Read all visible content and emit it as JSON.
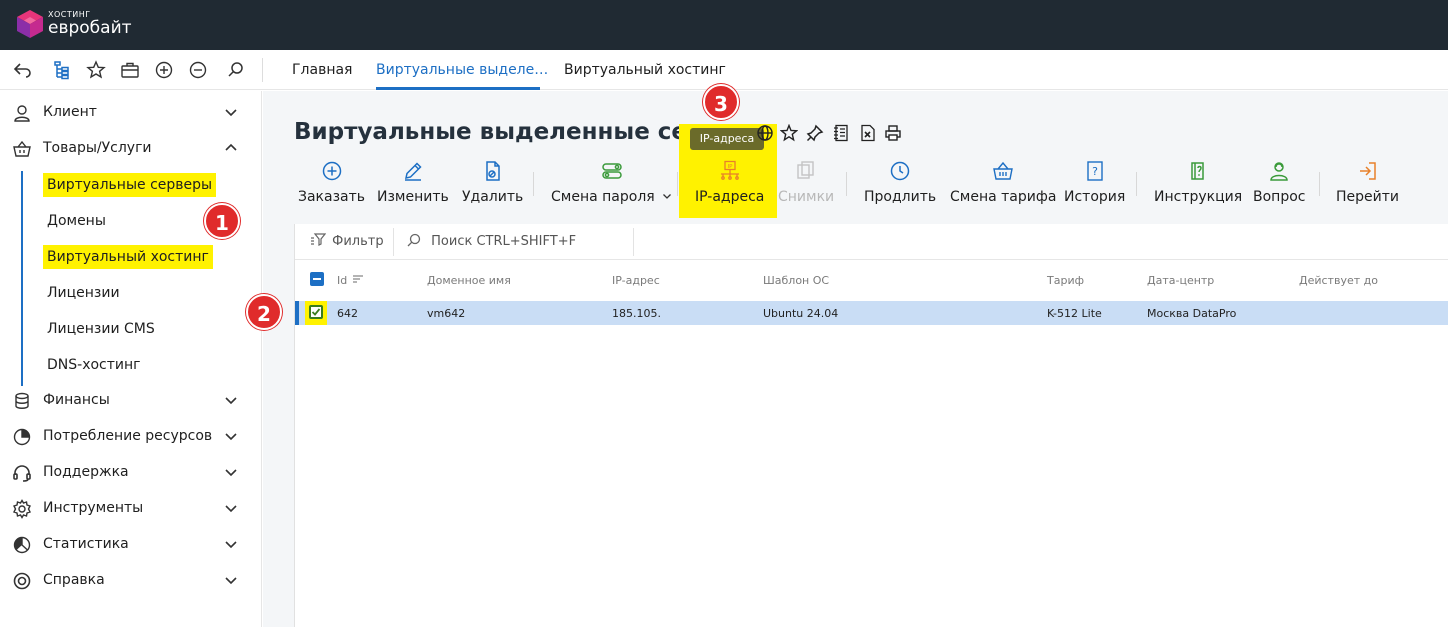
{
  "brand": {
    "small": "ХОСТИНГ",
    "big": "евробайт",
    "colors": {
      "topbar": "#202a33",
      "accent": "#1d6fc4",
      "highlight": "#fff200",
      "badge": "#e02b2b"
    }
  },
  "toolbar_icons": [
    "back-arrow-icon",
    "tree-icon",
    "star-icon",
    "briefcase-icon",
    "zoom-in-icon",
    "zoom-out-icon",
    "search-icon"
  ],
  "tabs": [
    {
      "label": "Главная",
      "active": false
    },
    {
      "label": "Виртуальные выделе…",
      "active": true
    },
    {
      "label": "Виртуальный хостинг",
      "active": false
    }
  ],
  "sidebar": {
    "items": [
      {
        "label": "Клиент",
        "icon": "user-icon",
        "expanded": false
      },
      {
        "label": "Товары/Услуги",
        "icon": "basket-icon",
        "expanded": true
      },
      {
        "label": "Финансы",
        "icon": "coins-icon",
        "expanded": false
      },
      {
        "label": "Потребление ресурсов",
        "icon": "pie-icon",
        "expanded": false
      },
      {
        "label": "Поддержка",
        "icon": "headset-icon",
        "expanded": false
      },
      {
        "label": "Инструменты",
        "icon": "gear-icon",
        "expanded": false
      },
      {
        "label": "Статистика",
        "icon": "chart-icon",
        "expanded": false
      },
      {
        "label": "Справка",
        "icon": "lifebuoy-icon",
        "expanded": false
      }
    ],
    "subitems": [
      {
        "label": "Виртуальные серверы",
        "highlighted": true
      },
      {
        "label": "Домены",
        "highlighted": false
      },
      {
        "label": "Виртуальный хостинг",
        "highlighted": true
      },
      {
        "label": "Лицензии",
        "highlighted": false
      },
      {
        "label": "Лицензии CMS",
        "highlighted": false
      },
      {
        "label": "DNS-хостинг",
        "highlighted": false
      }
    ]
  },
  "badges": [
    "1",
    "2",
    "3"
  ],
  "page": {
    "title": "Виртуальные выделенные серверы",
    "tooltip": "IP-адреса",
    "title_icons": [
      "globe-icon",
      "star-icon",
      "pin-icon",
      "notes-icon",
      "excel-icon",
      "print-icon"
    ]
  },
  "actions": [
    {
      "label": "Заказать",
      "icon": "plus-circle-icon",
      "disabled": false
    },
    {
      "label": "Изменить",
      "icon": "pencil-icon",
      "disabled": false
    },
    {
      "label": "Удалить",
      "icon": "delete-file-icon",
      "disabled": false
    },
    {
      "label": "Смена пароля",
      "icon": "key-toggle-icon",
      "disabled": false,
      "dropdown": true
    },
    {
      "label": "IP-адреса",
      "icon": "ip-icon",
      "disabled": false,
      "highlighted": true
    },
    {
      "label": "Снимки",
      "icon": "snapshot-icon",
      "disabled": true
    },
    {
      "label": "Продлить",
      "icon": "clock-icon",
      "disabled": false
    },
    {
      "label": "Смена тарифа",
      "icon": "basket-icon",
      "disabled": false
    },
    {
      "label": "История",
      "icon": "history-icon",
      "disabled": false
    },
    {
      "label": "Инструкция",
      "icon": "manual-icon",
      "disabled": false
    },
    {
      "label": "Вопрос",
      "icon": "support-user-icon",
      "disabled": false
    },
    {
      "label": "Перейти",
      "icon": "goto-icon",
      "disabled": false
    }
  ],
  "filter": {
    "label": "Фильтр",
    "search_placeholder": "Поиск CTRL+SHIFT+F"
  },
  "table": {
    "columns": [
      "Id",
      "Доменное имя",
      "IP-адрес",
      "Шаблон ОС",
      "Тариф",
      "Дата-центр",
      "Действует до"
    ],
    "rows": [
      {
        "id": "642",
        "domain": "vm642",
        "ip": "185.105.",
        "os": "Ubuntu 24.04",
        "tariff": "K-512 Lite",
        "dc": "Москва DataPro",
        "until": "",
        "selected": true
      }
    ]
  }
}
